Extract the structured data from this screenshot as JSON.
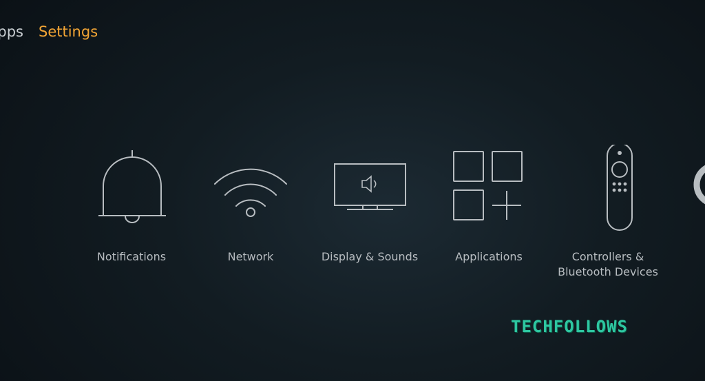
{
  "nav": {
    "items": [
      {
        "label": "Apps"
      },
      {
        "label": "Settings",
        "selected": true
      }
    ],
    "accent_color": "#f3a535"
  },
  "settings": {
    "tiles": [
      {
        "label": "Notifications",
        "icon": "bell-icon"
      },
      {
        "label": "Network",
        "icon": "wifi-icon"
      },
      {
        "label": "Display & Sounds",
        "icon": "tv-speaker-icon"
      },
      {
        "label": "Applications",
        "icon": "apps-grid-icon"
      },
      {
        "label": "Controllers &\nBluetooth Devices",
        "icon": "remote-icon"
      }
    ],
    "next_tile_icon": "ring-icon"
  },
  "watermark": {
    "text": "TECHFOLLOWS"
  }
}
